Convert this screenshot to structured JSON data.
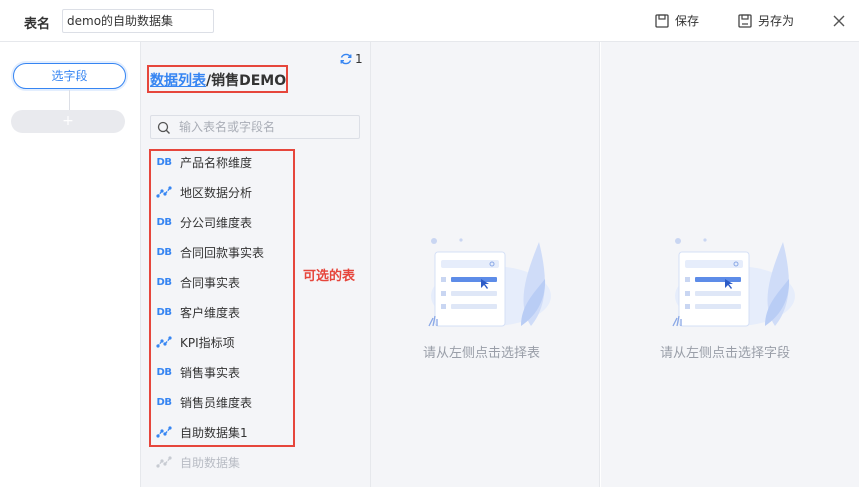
{
  "header": {
    "name_label": "表名",
    "name_value": "demo的自助数据集",
    "save_label": "保存",
    "save_as_label": "另存为"
  },
  "left": {
    "select_fields_label": "选字段",
    "add_symbol": "+"
  },
  "list": {
    "refresh_count": "1",
    "breadcrumb_link": "数据列表",
    "breadcrumb_sep": "/",
    "breadcrumb_current": "销售DEMO",
    "search_placeholder": "输入表名或字段名",
    "items": [
      {
        "label": "产品名称维度",
        "icon": "db-icon"
      },
      {
        "label": "地区数据分析",
        "icon": "analysis-icon"
      },
      {
        "label": "分公司维度表",
        "icon": "db-icon"
      },
      {
        "label": "合同回款事实表",
        "icon": "db-icon"
      },
      {
        "label": "合同事实表",
        "icon": "db-icon"
      },
      {
        "label": "客户维度表",
        "icon": "db-icon"
      },
      {
        "label": "KPI指标项",
        "icon": "analysis-icon"
      },
      {
        "label": "销售事实表",
        "icon": "db-icon"
      },
      {
        "label": "销售员维度表",
        "icon": "db-icon"
      },
      {
        "label": "自助数据集1",
        "icon": "analysis-icon"
      },
      {
        "label": "自助数据集",
        "icon": "analysis-icon",
        "disabled": true
      }
    ],
    "db_icon_text": "DB",
    "annotation": "可选的表"
  },
  "middle": {
    "empty_text": "请从左侧点击选择表"
  },
  "right": {
    "empty_text": "请从左侧点击选择字段"
  },
  "colors": {
    "accent": "#3685f2",
    "annotation_red": "#e6463c",
    "panel_bg": "#f4f5f8"
  }
}
